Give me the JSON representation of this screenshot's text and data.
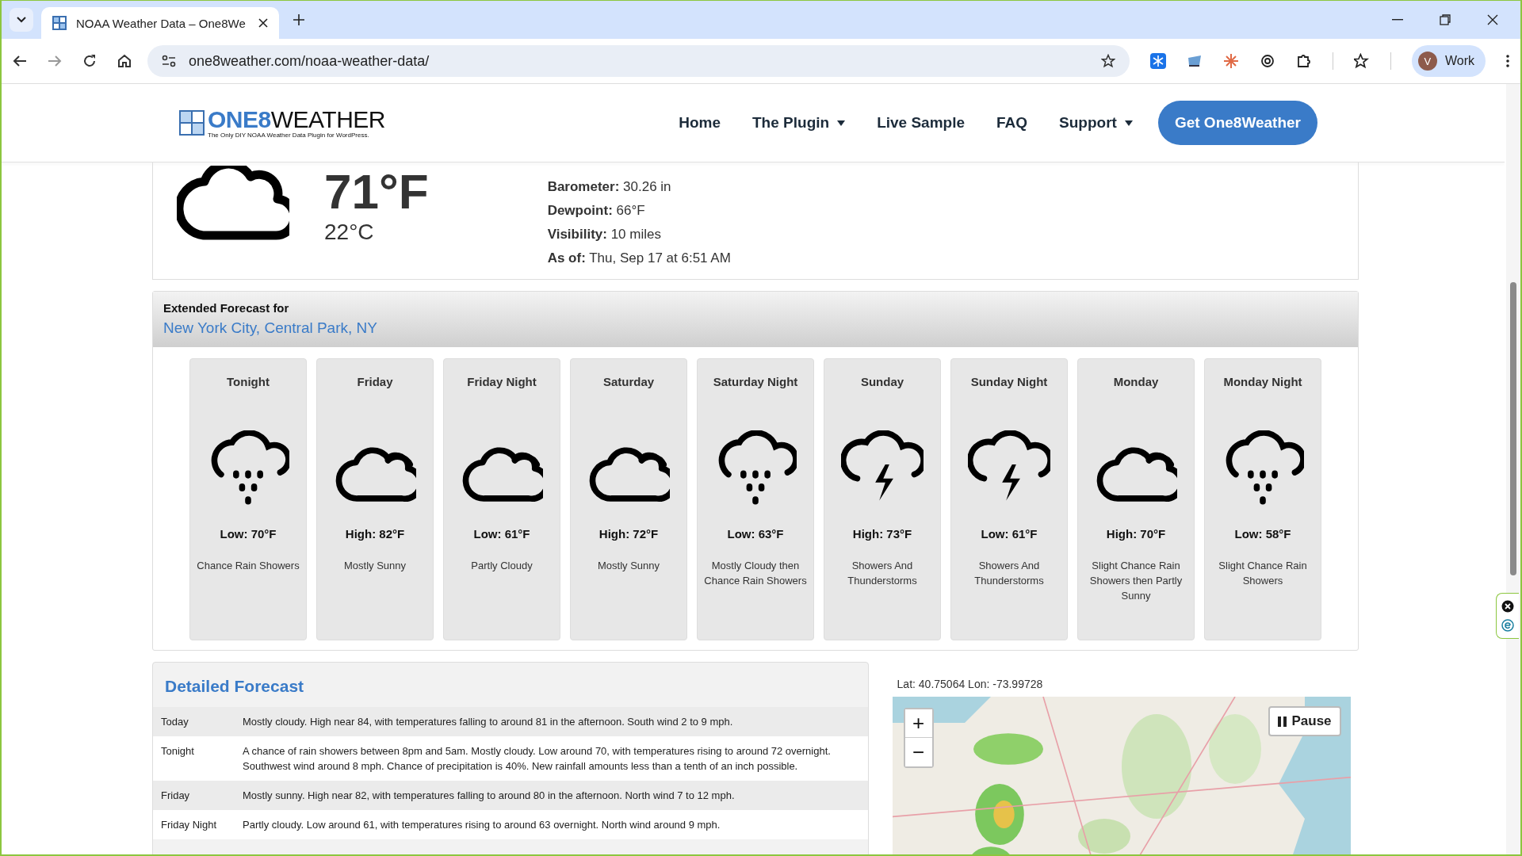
{
  "browser": {
    "tab_title": "NOAA Weather Data – One8We",
    "url": "one8weather.com/noaa-weather-data/",
    "profile_initial": "V",
    "profile_label": "Work"
  },
  "site_header": {
    "brand_a": "ONE8",
    "brand_b": "WEATHER",
    "tagline": "The Only DIY NOAA Weather Data Plugin for WordPress.",
    "nav": [
      {
        "label": "Home",
        "dropdown": false
      },
      {
        "label": "The Plugin",
        "dropdown": true
      },
      {
        "label": "Live Sample",
        "dropdown": false
      },
      {
        "label": "FAQ",
        "dropdown": false
      },
      {
        "label": "Support",
        "dropdown": true
      }
    ],
    "cta": "Get One8Weather"
  },
  "current": {
    "temp_f": "71°F",
    "temp_c": "22°C",
    "details": [
      "**Barometer:** 30.26 in",
      "**Dewpoint:** 66°F",
      "**Visibility:** 10 miles",
      "**As of:** Thu, Sep 17 at 6:51 AM"
    ]
  },
  "extended": {
    "heading": "Extended Forecast for",
    "location": "New York City, Central Park, NY",
    "periods": [
      {
        "name": "Tonight",
        "kind": "rain",
        "temp": "Low: 70°F",
        "summary": "Chance Rain Showers"
      },
      {
        "name": "Friday",
        "kind": "cloud",
        "temp": "High: 82°F",
        "summary": "Mostly Sunny"
      },
      {
        "name": "Friday Night",
        "kind": "cloud",
        "temp": "Low: 61°F",
        "summary": "Partly Cloudy"
      },
      {
        "name": "Saturday",
        "kind": "cloud",
        "temp": "High: 72°F",
        "summary": "Mostly Sunny"
      },
      {
        "name": "Saturday Night",
        "kind": "rain",
        "temp": "Low: 63°F",
        "summary": "Mostly Cloudy then Chance Rain Showers"
      },
      {
        "name": "Sunday",
        "kind": "storm",
        "temp": "High: 73°F",
        "summary": "Showers And Thunderstorms"
      },
      {
        "name": "Sunday Night",
        "kind": "storm",
        "temp": "Low: 61°F",
        "summary": "Showers And Thunderstorms"
      },
      {
        "name": "Monday",
        "kind": "cloud",
        "temp": "High: 70°F",
        "summary": "Slight Chance Rain Showers then Partly Sunny"
      },
      {
        "name": "Monday Night",
        "kind": "rain",
        "temp": "Low: 58°F",
        "summary": "Slight Chance Rain Showers"
      }
    ]
  },
  "detailed": {
    "title": "Detailed Forecast",
    "rows": [
      {
        "period": "Today",
        "text": "Mostly cloudy. High near 84, with temperatures falling to around 81 in the afternoon. South wind 2 to 9 mph."
      },
      {
        "period": "Tonight",
        "text": "A chance of rain showers between 8pm and 5am. Mostly cloudy. Low around 70, with temperatures rising to around 72 overnight. Southwest wind around 8 mph. Chance of precipitation is 40%. New rainfall amounts less than a tenth of an inch possible."
      },
      {
        "period": "Friday",
        "text": "Mostly sunny. High near 82, with temperatures falling to around 80 in the afternoon. North wind 7 to 12 mph."
      },
      {
        "period": "Friday Night",
        "text": "Partly cloudy. Low around 61, with temperatures rising to around 63 overnight. North wind around 9 mph."
      }
    ]
  },
  "map": {
    "coords": "Lat: 40.75064 Lon: -73.99728",
    "zoom_in": "+",
    "zoom_out": "−",
    "pause": "Pause"
  }
}
